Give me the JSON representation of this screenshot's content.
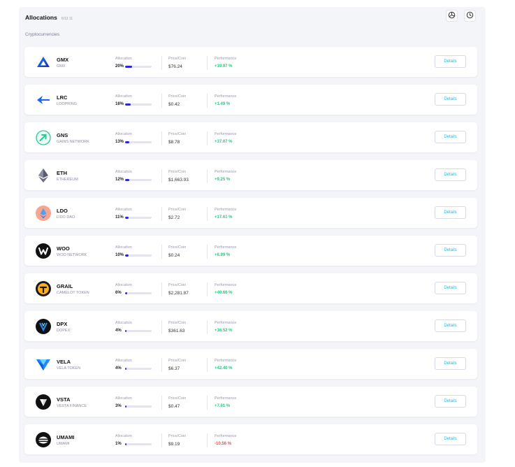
{
  "header": {
    "title": "Allocations",
    "date": "6/13 11"
  },
  "section": {
    "label": "Cryptocurrencies"
  },
  "columns": {
    "allocation": "Allocation",
    "price": "Price/Coin",
    "performance": "Performance"
  },
  "details_label": "Details",
  "colors": {
    "positive": "#1ccf7e",
    "negative": "#f04b4b",
    "bar": "#2d24d4",
    "button_text": "#2fb3d6"
  },
  "assets": [
    {
      "symbol": "GMX",
      "name": "GMX",
      "allocation": "20%",
      "allocation_fraction": 0.2,
      "price": "$76.24",
      "performance": "+19.97 %",
      "trend": "positive",
      "icon": "gmx-icon"
    },
    {
      "symbol": "LRC",
      "name": "LOOPRING",
      "allocation": "16%",
      "allocation_fraction": 0.16,
      "price": "$0.42",
      "performance": "+1.49 %",
      "trend": "positive",
      "icon": "lrc-icon"
    },
    {
      "symbol": "GNS",
      "name": "GAINS NETWORK",
      "allocation": "13%",
      "allocation_fraction": 0.13,
      "price": "$8.78",
      "performance": "+37.07 %",
      "trend": "positive",
      "icon": "gns-icon"
    },
    {
      "symbol": "ETH",
      "name": "ETHEREUM",
      "allocation": "12%",
      "allocation_fraction": 0.12,
      "price": "$1,663.93",
      "performance": "+9.25 %",
      "trend": "positive",
      "icon": "eth-icon"
    },
    {
      "symbol": "LDO",
      "name": "LIDO DAO",
      "allocation": "11%",
      "allocation_fraction": 0.11,
      "price": "$2.72",
      "performance": "+17.61 %",
      "trend": "positive",
      "icon": "ldo-icon"
    },
    {
      "symbol": "WOO",
      "name": "WOO NETWORK",
      "allocation": "10%",
      "allocation_fraction": 0.1,
      "price": "$0.24",
      "performance": "+6.99 %",
      "trend": "positive",
      "icon": "woo-icon"
    },
    {
      "symbol": "GRAIL",
      "name": "CAMELOT TOKEN",
      "allocation": "6%",
      "allocation_fraction": 0.06,
      "price": "$2,281.87",
      "performance": "+40.66 %",
      "trend": "positive",
      "icon": "grail-icon"
    },
    {
      "symbol": "DPX",
      "name": "DOPEX",
      "allocation": "4%",
      "allocation_fraction": 0.04,
      "price": "$361.63",
      "performance": "+16.52 %",
      "trend": "positive",
      "icon": "dpx-icon"
    },
    {
      "symbol": "VELA",
      "name": "VELA TOKEN",
      "allocation": "4%",
      "allocation_fraction": 0.04,
      "price": "$6.37",
      "performance": "+42.40 %",
      "trend": "positive",
      "icon": "vela-icon"
    },
    {
      "symbol": "VSTA",
      "name": "VESTA FINANCE",
      "allocation": "3%",
      "allocation_fraction": 0.03,
      "price": "$0.47",
      "performance": "+7.61 %",
      "trend": "positive",
      "icon": "vsta-icon"
    },
    {
      "symbol": "UMAMI",
      "name": "UMAMI",
      "allocation": "1%",
      "allocation_fraction": 0.01,
      "price": "$9.19",
      "performance": "-10.56 %",
      "trend": "negative",
      "icon": "umami-icon"
    }
  ]
}
